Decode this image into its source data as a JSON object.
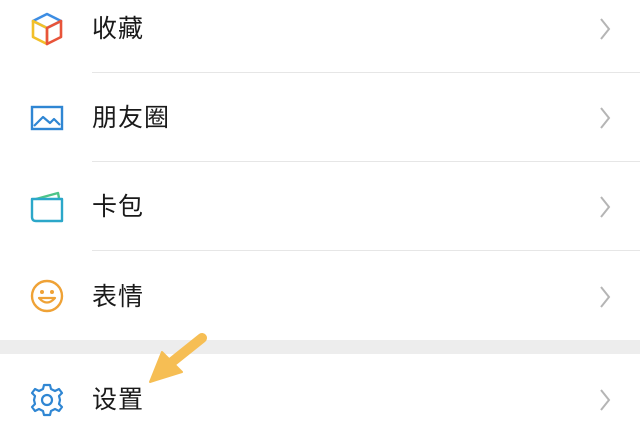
{
  "menu": {
    "items": [
      {
        "label": "收藏",
        "icon": "favorites-cube-icon"
      },
      {
        "label": "朋友圈",
        "icon": "moments-picture-icon"
      },
      {
        "label": "卡包",
        "icon": "card-wallet-icon"
      },
      {
        "label": "表情",
        "icon": "smiley-face-icon"
      }
    ],
    "settings": {
      "label": "设置",
      "icon": "gear-icon"
    }
  },
  "annotation": {
    "icon": "pointing-arrow-icon",
    "color": "#F6BE54"
  },
  "colors": {
    "favorites_blue": "#3D8DE3",
    "favorites_yellow": "#F2C029",
    "favorites_red": "#E8543A",
    "moments_blue": "#2F86D3",
    "card_teal": "#2BA7C9",
    "card_green": "#4DC489",
    "smiley_orange": "#EFA236",
    "settings_blue": "#2F86D3",
    "chevron_gray": "#B5B5B5"
  }
}
